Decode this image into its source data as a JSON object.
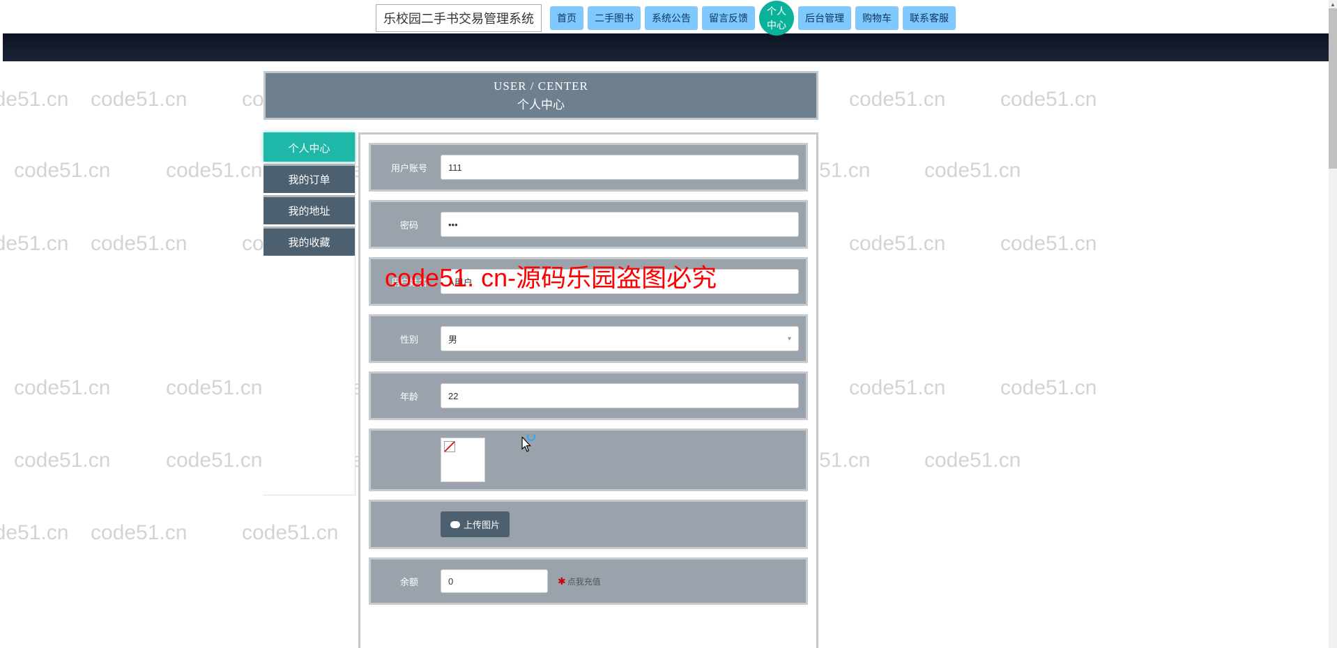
{
  "brand": "乐校园二手书交易管理系统",
  "nav": {
    "home": "首页",
    "books": "二手图书",
    "notice": "系统公告",
    "feedback": "留言反馈",
    "center": "个人中心",
    "admin": "后台管理",
    "cart": "购物车",
    "service": "联系客服"
  },
  "page_header": {
    "en": "USER / CENTER",
    "cn": "个人中心"
  },
  "sidebar": {
    "items": [
      {
        "label": "个人中心"
      },
      {
        "label": "我的订单"
      },
      {
        "label": "我的地址"
      },
      {
        "label": "我的收藏"
      }
    ]
  },
  "form": {
    "username": {
      "label": "用户账号",
      "value": "111"
    },
    "password": {
      "label": "密码",
      "value": "•••"
    },
    "realname": {
      "label": "用户姓名",
      "value": "A用户"
    },
    "gender": {
      "label": "性别",
      "value": "男"
    },
    "age": {
      "label": "年龄",
      "value": "22"
    },
    "upload": {
      "label": "上传图片"
    },
    "balance": {
      "label": "余额",
      "value": "0",
      "recharge": "点我充值"
    }
  },
  "watermark_text": "code51.cn",
  "watermark_banner": "code51. cn-源码乐园盗图必究"
}
